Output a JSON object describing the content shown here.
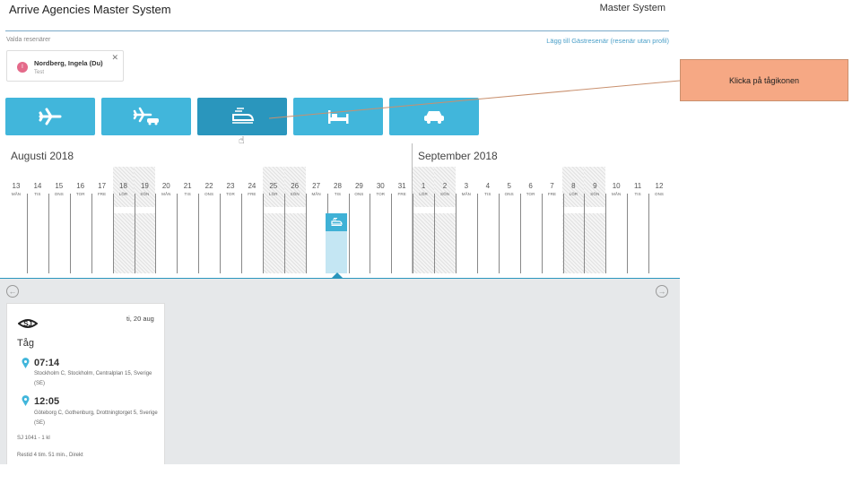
{
  "header": {
    "app_title": "Arrive Agencies Master System",
    "system_label": "Master System"
  },
  "travelers": {
    "section_label": "Valda resenärer",
    "guest_link": "Lägg till Gästresenär (resenär utan profil)",
    "items": [
      {
        "initial": "I",
        "name": "Nordberg, Ingela (Du)",
        "subtitle": "Test",
        "avatar_color": "#e46a8a"
      }
    ]
  },
  "transport_modes": [
    {
      "name": "flight",
      "icon": "airplane-icon",
      "active": false
    },
    {
      "name": "flight-and-car",
      "icon": "airplane-car-icon",
      "active": false
    },
    {
      "name": "train",
      "icon": "train-icon",
      "active": true
    },
    {
      "name": "hotel",
      "icon": "bed-icon",
      "active": false
    },
    {
      "name": "car",
      "icon": "car-icon",
      "active": false
    }
  ],
  "calendar": {
    "months": [
      "Augusti 2018",
      "September 2018"
    ],
    "days": [
      {
        "n": "13",
        "wd": "MÅN"
      },
      {
        "n": "14",
        "wd": "TIS"
      },
      {
        "n": "15",
        "wd": "ONS"
      },
      {
        "n": "16",
        "wd": "TOR"
      },
      {
        "n": "17",
        "wd": "FRE"
      },
      {
        "n": "18",
        "wd": "LÖR"
      },
      {
        "n": "19",
        "wd": "SÖN"
      },
      {
        "n": "20",
        "wd": "MÅN"
      },
      {
        "n": "21",
        "wd": "TIS"
      },
      {
        "n": "22",
        "wd": "ONS"
      },
      {
        "n": "23",
        "wd": "TOR"
      },
      {
        "n": "24",
        "wd": "FRE"
      },
      {
        "n": "25",
        "wd": "LÖR"
      },
      {
        "n": "26",
        "wd": "SÖN"
      },
      {
        "n": "27",
        "wd": "MÅN"
      },
      {
        "n": "28",
        "wd": "TIS"
      },
      {
        "n": "29",
        "wd": "ONS"
      },
      {
        "n": "30",
        "wd": "TOR"
      },
      {
        "n": "31",
        "wd": "FRE"
      },
      {
        "n": "1",
        "wd": "LÖR"
      },
      {
        "n": "2",
        "wd": "SÖN"
      },
      {
        "n": "3",
        "wd": "MÅN"
      },
      {
        "n": "4",
        "wd": "TIS"
      },
      {
        "n": "5",
        "wd": "ONS"
      },
      {
        "n": "6",
        "wd": "TOR"
      },
      {
        "n": "7",
        "wd": "FRE"
      },
      {
        "n": "8",
        "wd": "LÖR"
      },
      {
        "n": "9",
        "wd": "SÖN"
      },
      {
        "n": "10",
        "wd": "MÅN"
      },
      {
        "n": "11",
        "wd": "TIS"
      },
      {
        "n": "12",
        "wd": "ONS"
      }
    ],
    "selected_day": "28",
    "accent_color": "#41b6db"
  },
  "trip_card": {
    "date": "ti, 20 aug",
    "type": "Tåg",
    "departure_time": "07:14",
    "departure_address": "Stockholm C, Stockholm, Centralplan 15, Sverige (SE)",
    "arrival_time": "12:05",
    "arrival_address": "Göteborg C, Gothenburg, Drottningtorget 5, Sverige (SE)",
    "train_info": "SJ 1041 - 1 kl",
    "duration": "Restid 4 tim. 51 min., Direkt"
  },
  "annotation": {
    "callout_text": "Klicka på tågikonen",
    "callout_color": "#f6a884"
  }
}
